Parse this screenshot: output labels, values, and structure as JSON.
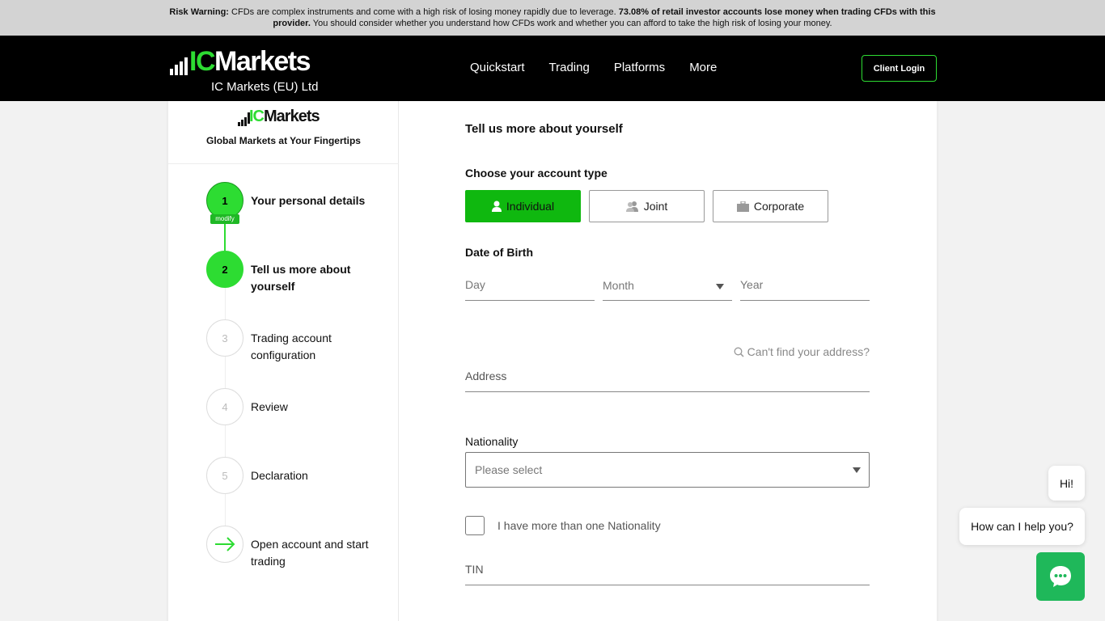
{
  "risk_warning": {
    "label": "Risk Warning:",
    "text1": " CFDs are complex instruments and come with a high risk of losing money rapidly due to leverage. ",
    "bold_stat": "73.08% of retail investor accounts lose money when trading CFDs with this provider.",
    "text2": " You should consider whether you understand how CFDs work and whether you can afford to take the high risk of losing your money."
  },
  "header": {
    "logo_ic": "IC",
    "logo_markets": "Markets",
    "entity": "IC Markets (EU) Ltd",
    "menu": [
      "Quickstart",
      "Trading",
      "Platforms",
      "More"
    ],
    "login_label": "Client Login"
  },
  "sidebar": {
    "logo_ic": "IC",
    "logo_markets": "Markets",
    "tagline": "Global Markets at Your Fingertips",
    "modify_label": "modify",
    "steps": [
      {
        "num": "1",
        "label": "Your personal details"
      },
      {
        "num": "2",
        "label": "Tell us more about yourself"
      },
      {
        "num": "3",
        "label": "Trading account configuration"
      },
      {
        "num": "4",
        "label": "Review"
      },
      {
        "num": "5",
        "label": "Declaration"
      },
      {
        "num": "",
        "label": "Open account and start trading"
      }
    ]
  },
  "form": {
    "heading": "Tell us more about yourself",
    "account_type_label": "Choose your account type",
    "account_types": [
      "Individual",
      "Joint",
      "Corporate"
    ],
    "dob_label": "Date of Birth",
    "day_placeholder": "Day",
    "month_placeholder": "Month",
    "year_placeholder": "Year",
    "cant_find": "Can't find your address?",
    "address_placeholder": "Address",
    "nationality_label": "Nationality",
    "nationality_placeholder": "Please select",
    "multi_nationality": "I have more than one Nationality",
    "tin_placeholder": "TIN"
  },
  "chat": {
    "greeting": "Hi!",
    "prompt": "How can I help you?"
  },
  "colors": {
    "brand_green": "#2ddc32",
    "selected_green": "#0fb80f",
    "chat_green": "#1fb85a"
  }
}
